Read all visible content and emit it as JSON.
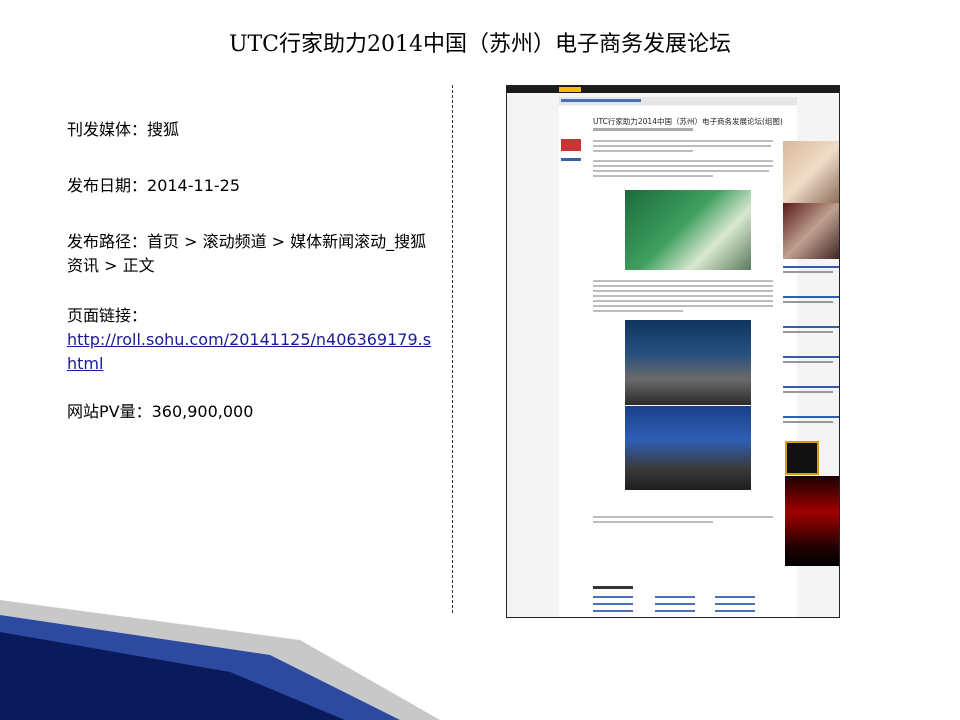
{
  "title": "UTC行家助力2014中国（苏州）电子商务发展论坛",
  "info": {
    "media_label": "刊发媒体：",
    "media_value": "搜狐",
    "date_label": "发布日期：",
    "date_value": "2014-11-25",
    "path_label": "发布路径：",
    "path_value": "首页 > 滚动频道 > 媒体新闻滚动_搜狐资讯 > 正文",
    "link_label": "页面链接：",
    "link_url": "http://roll.sohu.com/20141125/n406369179.shtml",
    "pv_label": "网站PV量：",
    "pv_value": "360,900,000"
  },
  "screenshot": {
    "article_title": "UTC行家助力2014中国（苏州）电子商务发展论坛(组图)"
  },
  "colors": {
    "bottom_band_dark": "#0b1a5a",
    "bottom_band_mid": "#2c4aa0",
    "bottom_band_light": "#c8c8c8",
    "link": "#1a1a9a"
  }
}
